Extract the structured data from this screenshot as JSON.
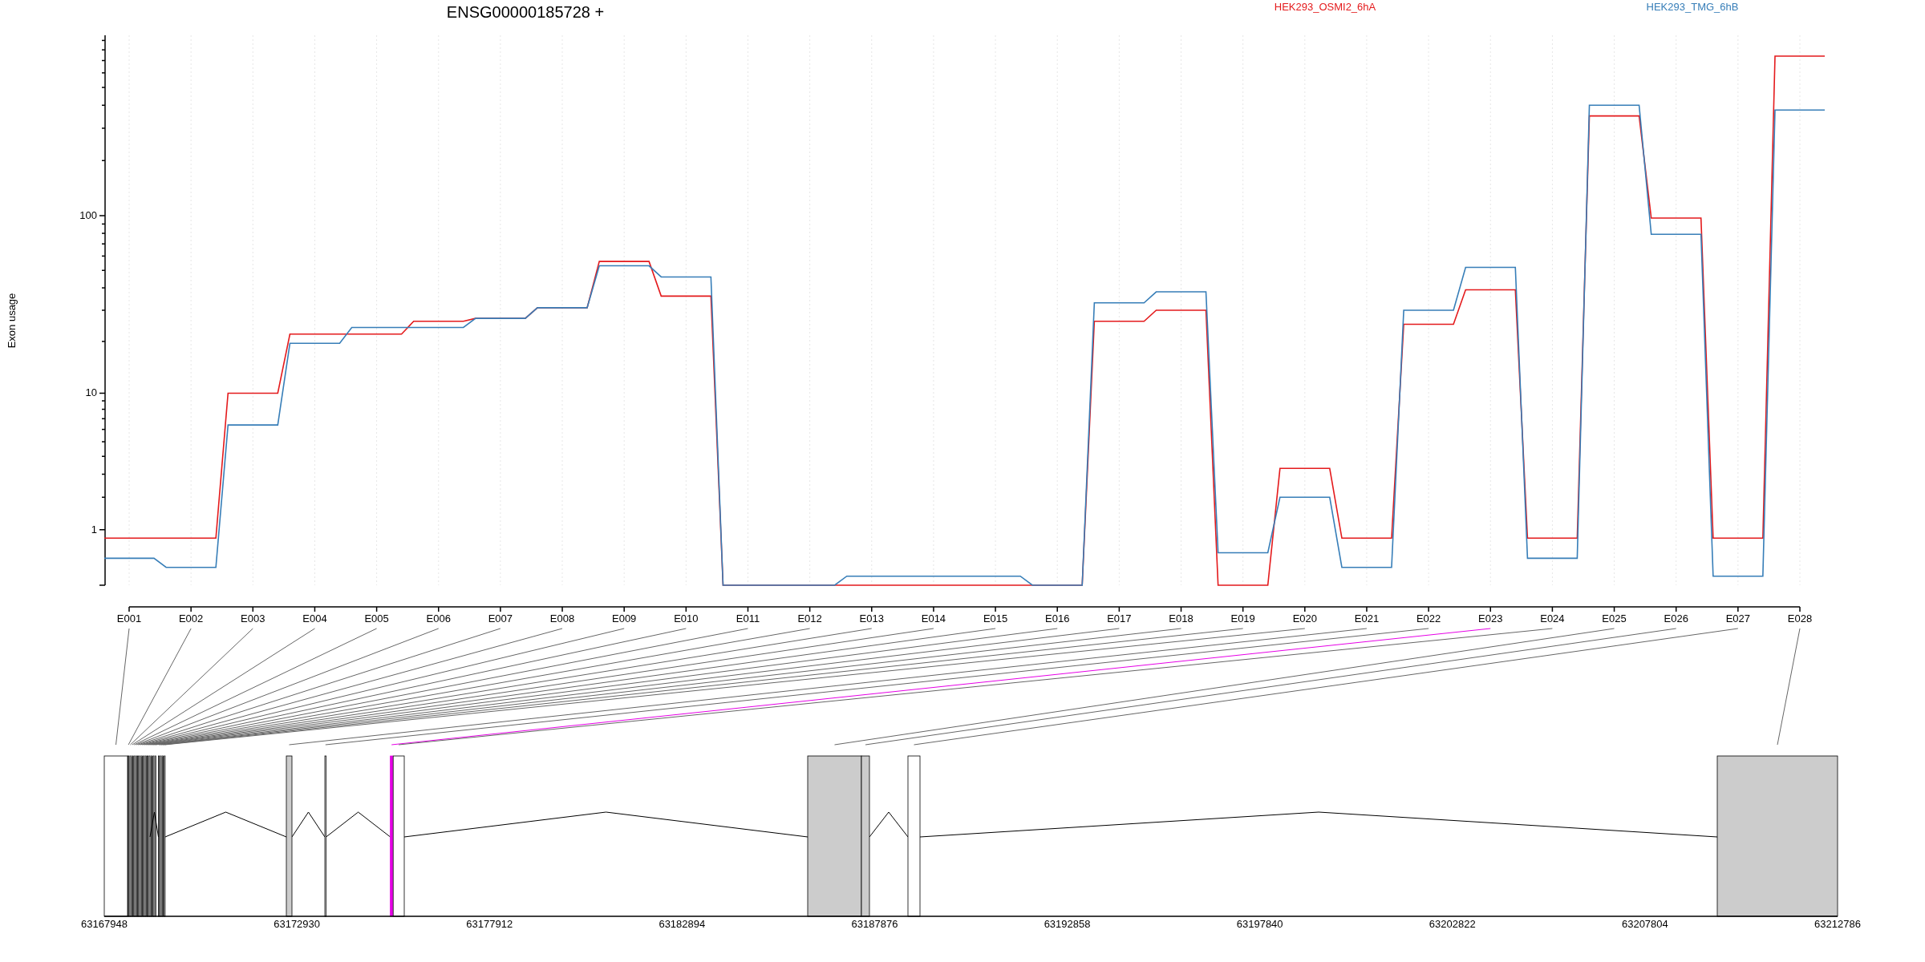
{
  "plot": {
    "title": "ENSG00000185728 +",
    "ylabel": "Exon usage",
    "legend": [
      {
        "label": "HEK293_OSMI2_6hA",
        "color": "#e41a1c"
      },
      {
        "label": "HEK293_TMG_6hB",
        "color": "#377eb8"
      }
    ],
    "y_labels": [
      "100",
      "10",
      "1"
    ],
    "x_labels": [
      "E001",
      "E002",
      "E003",
      "E004",
      "E005",
      "E006",
      "E007",
      "E008",
      "E009",
      "E010",
      "E011",
      "E012",
      "E013",
      "E014",
      "E015",
      "E016",
      "E017",
      "E018",
      "E019",
      "E020",
      "E021",
      "E022",
      "E023",
      "E024",
      "E025",
      "E026",
      "E027",
      "E028"
    ]
  },
  "gene_model": {
    "axis_labels": [
      "63167948",
      "63172930",
      "63177912",
      "63182894",
      "63187876",
      "63192858",
      "63197840",
      "63202822",
      "63207804",
      "63212786"
    ],
    "exons": [
      {
        "color": "#ffffff"
      },
      {
        "color": "#cccccc"
      },
      {
        "color": "#e600e6"
      },
      {
        "color": "#ffffff"
      },
      {
        "color": "#cccccc"
      },
      {
        "color": "#cccccc"
      },
      {
        "color": "#ffffff"
      },
      {
        "color": "#cccccc"
      }
    ]
  }
}
